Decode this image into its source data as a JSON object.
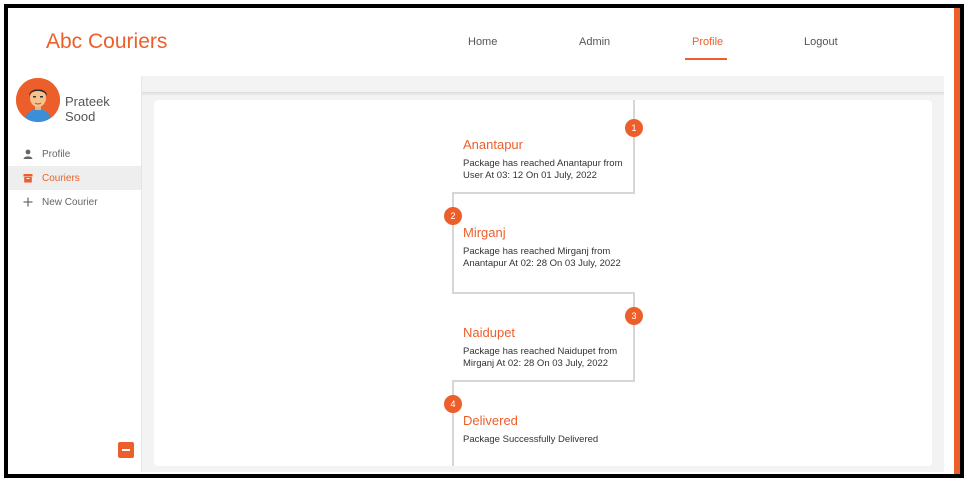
{
  "header": {
    "brand": "Abc Couriers",
    "nav": [
      {
        "label": "Home",
        "active": false
      },
      {
        "label": "Admin",
        "active": false
      },
      {
        "label": "Profile",
        "active": true
      },
      {
        "label": "Logout",
        "active": false
      }
    ]
  },
  "sidebar": {
    "user_name": "Prateek Sood",
    "items": [
      {
        "label": "Profile",
        "icon": "person-icon",
        "active": false
      },
      {
        "label": "Couriers",
        "icon": "archive-box-icon",
        "active": true
      },
      {
        "label": "New Courier",
        "icon": "plus-icon",
        "active": false
      }
    ]
  },
  "timeline": [
    {
      "step": "1",
      "city": "Anantapur",
      "desc": "Package has reached Anantapur from User At 03: 12 On 01 July, 2022"
    },
    {
      "step": "2",
      "city": "Mirganj",
      "desc": "Package has reached Mirganj from Anantapur At 02: 28 On 03 July, 2022"
    },
    {
      "step": "3",
      "city": "Naidupet",
      "desc": "Package has reached Naidupet from Mirganj At 02: 28 On 03 July, 2022"
    },
    {
      "step": "4",
      "city": "Delivered",
      "desc": "Package Successfully Delivered"
    }
  ],
  "colors": {
    "accent": "#ec5f2b"
  }
}
